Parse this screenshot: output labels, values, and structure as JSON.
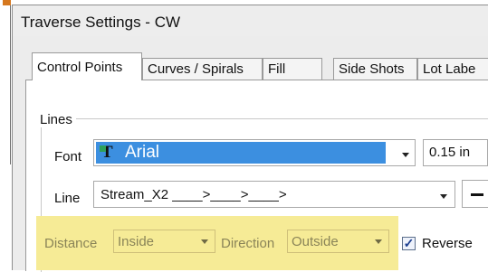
{
  "window": {
    "title": "Traverse Settings - CW"
  },
  "tabs": [
    {
      "label": "Control Points"
    },
    {
      "label": "Curves / Spirals"
    },
    {
      "label": "Fill"
    },
    {
      "label": "Side Shots"
    },
    {
      "label": "Lot Labe"
    }
  ],
  "lines_group": {
    "title": "Lines",
    "font_label": "Font",
    "font_value": "Arial",
    "size_value": "0.15 in",
    "line_label": "Line",
    "line_value": "Stream_X2  ____>____>____>",
    "distance_label": "Distance",
    "distance_value": "Inside",
    "direction_label": "Direction",
    "direction_value": "Outside",
    "reverse_label": "Reverse",
    "reverse_checked": true
  },
  "icons": [
    "truetype-font-icon",
    "dropdown-arrow-icon",
    "checkmark-icon",
    "line-style-icon"
  ],
  "colors": {
    "selection": "#3c8fe0",
    "highlight": "#f6eb96",
    "mark": "#d6781f"
  }
}
